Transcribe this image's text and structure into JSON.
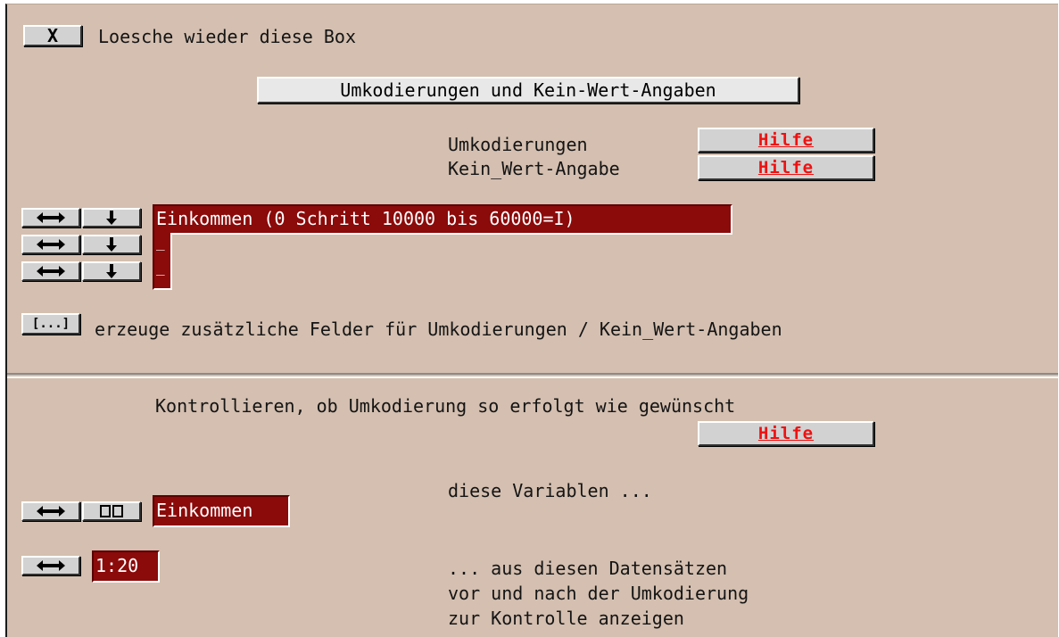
{
  "close_box": {
    "button_label": "X",
    "label": "Loesche wieder diese Box"
  },
  "header": {
    "title_button": "Umkodierungen und Kein-Wert-Angaben"
  },
  "help": {
    "umkodierungen_label": "Umkodierungen",
    "keinwert_label": "Kein_Wert-Angabe",
    "button_label": "Hilfe"
  },
  "recode": {
    "fields": [
      "Einkommen (0 Schritt 10000 bis 60000=I)",
      "_",
      "_"
    ],
    "swap_icon": "left-right-arrow-icon",
    "down_icon": "down-arrow-icon"
  },
  "add_fields": {
    "button_label": "[...]",
    "label": "erzeuge zusätzliche Felder für Umkodierungen / Kein_Wert-Angaben"
  },
  "control": {
    "heading": "Kontrollieren, ob Umkodierung so erfolgt wie gewünscht",
    "help_label": "Hilfe",
    "variables_label": "diese Variablen ...",
    "variable_value": "Einkommen",
    "records_value": "1:20",
    "records_line1": "... aus diesen Datensätzen",
    "records_line2": "vor und nach der Umkodierung",
    "records_line3": "zur Kontrolle anzeigen",
    "columns_icon": "columns-icon"
  },
  "colors": {
    "panel_bg": "#d4bfb0",
    "field_bg": "#8b0a0a",
    "hilfe_text": "#ee1111"
  }
}
